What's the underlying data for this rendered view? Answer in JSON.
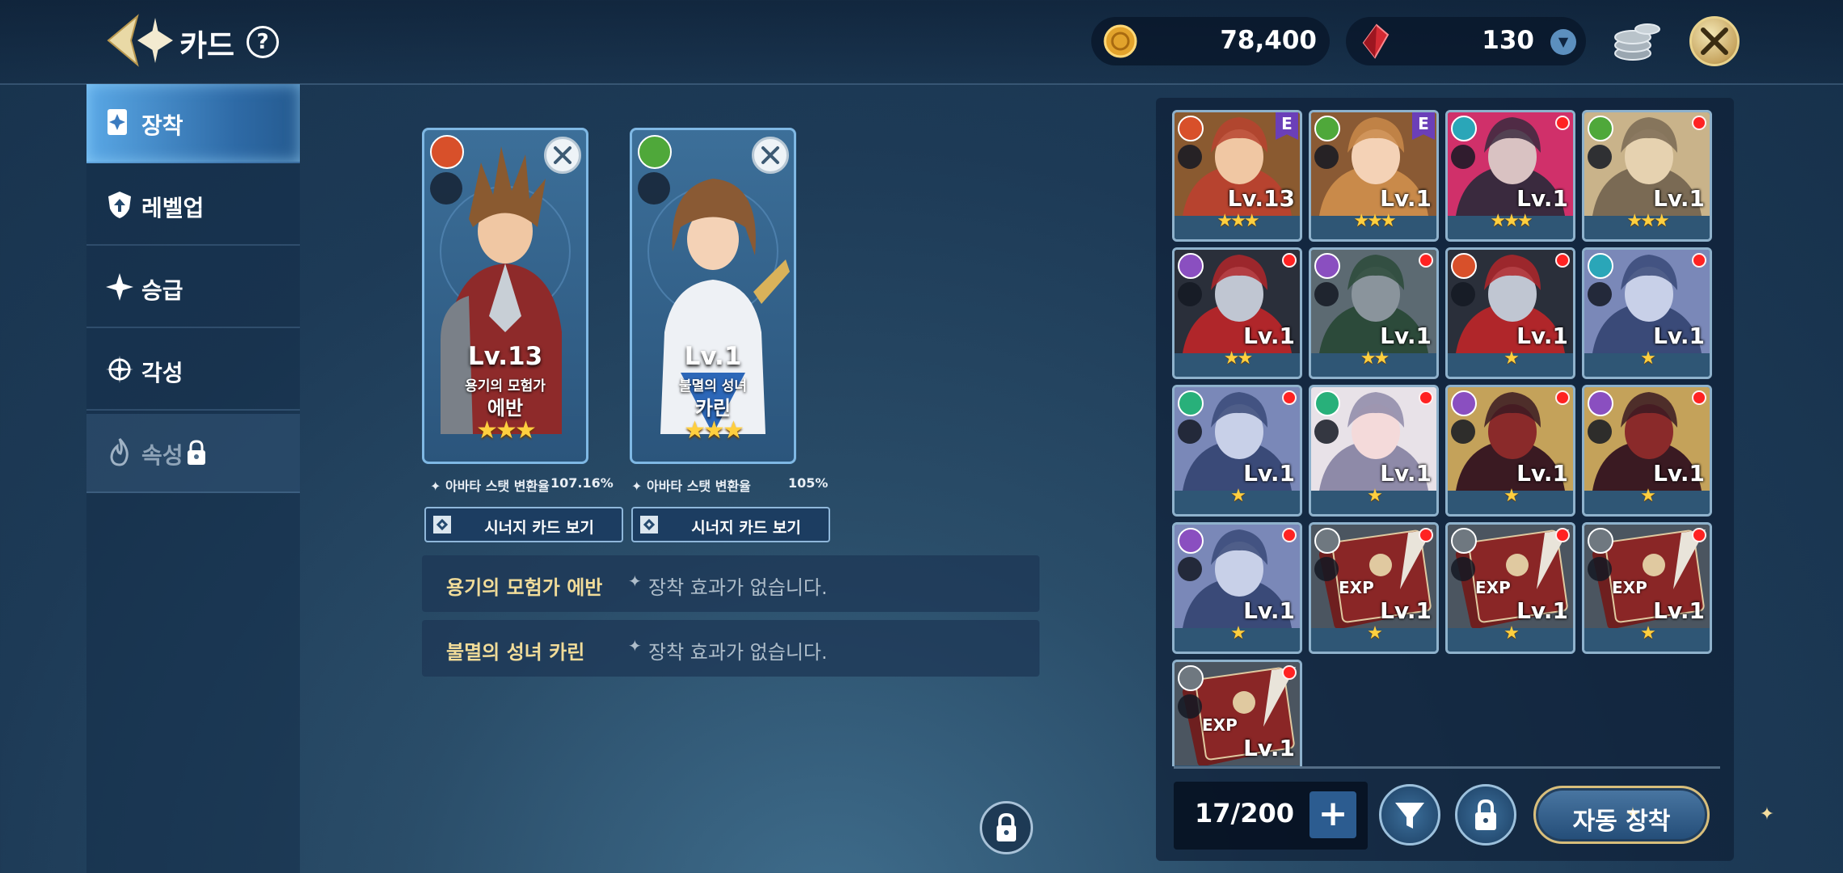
{
  "header": {
    "title": "카드",
    "help_label": "?",
    "gold": "78,400",
    "gems": "130"
  },
  "nav": {
    "items": [
      {
        "label": "장착"
      },
      {
        "label": "레벨업"
      },
      {
        "label": "승급"
      },
      {
        "label": "각성"
      },
      {
        "label": "속성"
      }
    ]
  },
  "equipped": [
    {
      "level": "Lv.13",
      "subtitle": "용기의 모험가",
      "name": "에반",
      "stars": "★★★",
      "element": "fire",
      "stat_label": "아바타 스탯 변환율",
      "stat_value": "107.16%",
      "synergy_label": "시너지 카드 보기"
    },
    {
      "level": "Lv.1",
      "subtitle": "불멸의 성녀",
      "name": "카린",
      "stars": "★★★",
      "element": "nature",
      "stat_label": "아바타 스탯 변환율",
      "stat_value": "105%",
      "synergy_label": "시너지 카드 보기"
    }
  ],
  "effects": [
    {
      "name": "용기의 모험가 에반",
      "desc": "장착 효과가 없습니다."
    },
    {
      "name": "불멸의 성녀 카린",
      "desc": "장착 효과가 없습니다."
    }
  ],
  "inventory": {
    "cards": [
      {
        "level": "Lv.13",
        "stars": "★★★",
        "element": "fire",
        "badge": "E"
      },
      {
        "level": "Lv.1",
        "stars": "★★★",
        "element": "nature",
        "badge": "E"
      },
      {
        "level": "Lv.1",
        "stars": "★★★",
        "element": "water"
      },
      {
        "level": "Lv.1",
        "stars": "★★★",
        "element": "nature"
      },
      {
        "level": "Lv.1",
        "stars": "★★",
        "element": "dark"
      },
      {
        "level": "Lv.1",
        "stars": "★★",
        "element": "dark"
      },
      {
        "level": "Lv.1",
        "stars": "★",
        "element": "fire"
      },
      {
        "level": "Lv.1",
        "stars": "★",
        "element": "water"
      },
      {
        "level": "Lv.1",
        "stars": "★",
        "element": "wind"
      },
      {
        "level": "Lv.1",
        "stars": "★",
        "element": "wind"
      },
      {
        "level": "Lv.1",
        "stars": "★",
        "element": "dark"
      },
      {
        "level": "Lv.1",
        "stars": "★",
        "element": "dark"
      },
      {
        "level": "Lv.1",
        "stars": "★",
        "element": "dark"
      },
      {
        "level": "Lv.1",
        "stars": "★",
        "element": "neutral",
        "exp": "EXP"
      },
      {
        "level": "Lv.1",
        "stars": "★",
        "element": "neutral",
        "exp": "EXP"
      },
      {
        "level": "Lv.1",
        "stars": "★",
        "element": "neutral",
        "exp": "EXP"
      },
      {
        "level": "Lv.1",
        "stars": "",
        "element": "neutral",
        "exp": "EXP"
      }
    ],
    "count": "17/200",
    "plus_label": "+",
    "auto_equip_label": "자동 장착"
  },
  "colors": {
    "fire": "#d8502a",
    "nature": "#4fa83a",
    "water": "#2aa6b8",
    "dark": "#8a4fc0",
    "wind": "#28b07a",
    "neutral": "#6f7880",
    "gold_accent": "#f1dc99"
  }
}
